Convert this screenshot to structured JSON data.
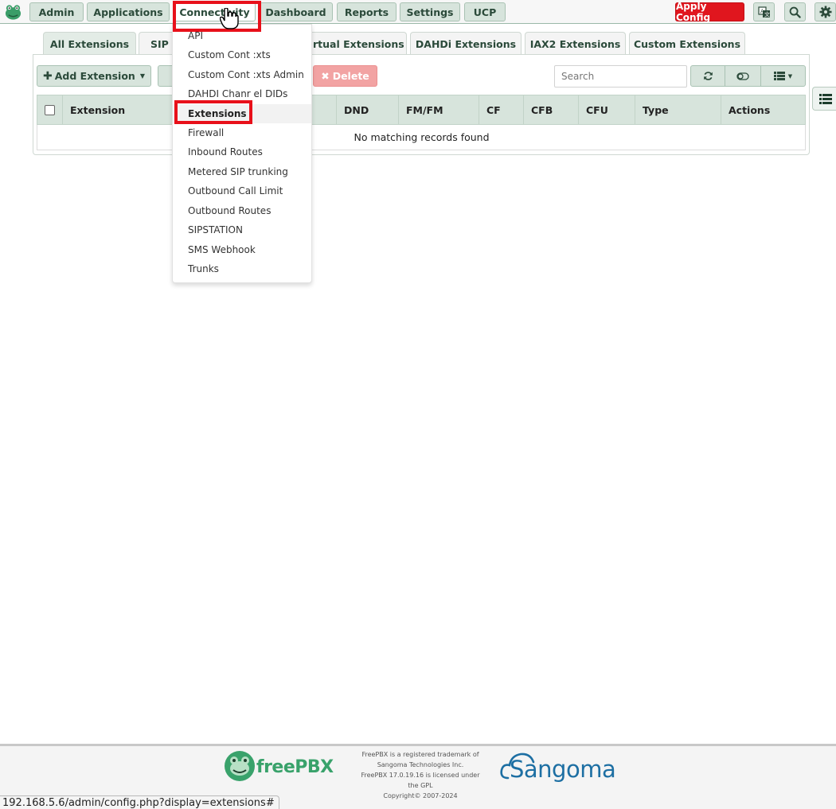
{
  "menu": {
    "items": [
      {
        "label": "Admin"
      },
      {
        "label": "Applications"
      },
      {
        "label": "Connectivity"
      },
      {
        "label": "Dashboard"
      },
      {
        "label": "Reports"
      },
      {
        "label": "Settings"
      },
      {
        "label": "UCP"
      }
    ],
    "apply_label": "Apply Config"
  },
  "tabs": [
    {
      "label": "All Extensions"
    },
    {
      "label": "SIP ["
    },
    {
      "label": "Virtual Extensions"
    },
    {
      "label": "DAHDi Extensions"
    },
    {
      "label": "IAX2 Extensions"
    },
    {
      "label": "Custom Extensions"
    }
  ],
  "toolbar": {
    "add_label": "Add Extension",
    "delete_label": "Delete",
    "search_placeholder": "Search"
  },
  "table": {
    "columns": [
      "Extension",
      "DND",
      "FM/FM",
      "CF",
      "CFB",
      "CFU",
      "Type",
      "Actions"
    ],
    "empty_message": "No matching records found"
  },
  "dropdown": {
    "items": [
      {
        "label": "API"
      },
      {
        "label": "Custom Cont :xts"
      },
      {
        "label": "Custom Cont :xts Admin"
      },
      {
        "label": "DAHDI Chanr el DIDs"
      },
      {
        "label": "Extensions"
      },
      {
        "label": "Firewall"
      },
      {
        "label": "Inbound Routes"
      },
      {
        "label": "Metered SIP trunking"
      },
      {
        "label": "Outbound Call Limit"
      },
      {
        "label": "Outbound Routes"
      },
      {
        "label": "SIPSTATION"
      },
      {
        "label": "SMS Webhook"
      },
      {
        "label": "Trunks"
      }
    ]
  },
  "footer": {
    "freepbx_logo_text": "freePBX",
    "note_lines": [
      "FreePBX is a registered trademark of",
      "Sangoma Technologies Inc.",
      "FreePBX 17.0.19.16 is licensed under",
      "the GPL",
      "Copyright© 2007-2024"
    ],
    "sangoma_logo_text": "Sangoma"
  },
  "statusbar": {
    "url": "192.168.5.6/admin/config.php?display=extensions#"
  },
  "colors": {
    "accent_green": "#d7e4dc",
    "apply_red": "#e0161e",
    "annotation_red": "#e8101a",
    "delete_pink": "#f2a3a3",
    "freepbx_green": "#39a26b",
    "sangoma_blue": "#1d6fa3"
  },
  "icons": [
    "frog-logo-icon",
    "language-icon",
    "search-icon",
    "gear-icon",
    "plus-icon",
    "caret-down-icon",
    "times-icon",
    "refresh-icon",
    "toggle-icon",
    "list-icon",
    "hand-cursor-icon"
  ]
}
